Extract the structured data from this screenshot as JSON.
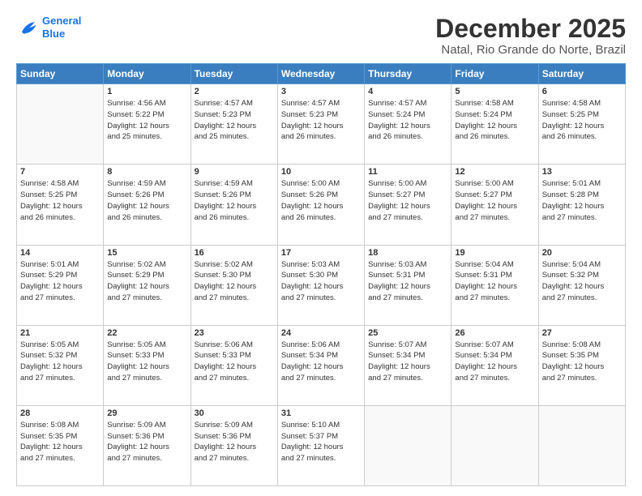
{
  "logo": {
    "line1": "General",
    "line2": "Blue"
  },
  "title": "December 2025",
  "subtitle": "Natal, Rio Grande do Norte, Brazil",
  "weekdays": [
    "Sunday",
    "Monday",
    "Tuesday",
    "Wednesday",
    "Thursday",
    "Friday",
    "Saturday"
  ],
  "weeks": [
    [
      {
        "day": "",
        "lines": []
      },
      {
        "day": "1",
        "lines": [
          "Sunrise: 4:56 AM",
          "Sunset: 5:22 PM",
          "Daylight: 12 hours",
          "and 25 minutes."
        ]
      },
      {
        "day": "2",
        "lines": [
          "Sunrise: 4:57 AM",
          "Sunset: 5:23 PM",
          "Daylight: 12 hours",
          "and 25 minutes."
        ]
      },
      {
        "day": "3",
        "lines": [
          "Sunrise: 4:57 AM",
          "Sunset: 5:23 PM",
          "Daylight: 12 hours",
          "and 26 minutes."
        ]
      },
      {
        "day": "4",
        "lines": [
          "Sunrise: 4:57 AM",
          "Sunset: 5:24 PM",
          "Daylight: 12 hours",
          "and 26 minutes."
        ]
      },
      {
        "day": "5",
        "lines": [
          "Sunrise: 4:58 AM",
          "Sunset: 5:24 PM",
          "Daylight: 12 hours",
          "and 26 minutes."
        ]
      },
      {
        "day": "6",
        "lines": [
          "Sunrise: 4:58 AM",
          "Sunset: 5:25 PM",
          "Daylight: 12 hours",
          "and 26 minutes."
        ]
      }
    ],
    [
      {
        "day": "7",
        "lines": [
          "Sunrise: 4:58 AM",
          "Sunset: 5:25 PM",
          "Daylight: 12 hours",
          "and 26 minutes."
        ]
      },
      {
        "day": "8",
        "lines": [
          "Sunrise: 4:59 AM",
          "Sunset: 5:26 PM",
          "Daylight: 12 hours",
          "and 26 minutes."
        ]
      },
      {
        "day": "9",
        "lines": [
          "Sunrise: 4:59 AM",
          "Sunset: 5:26 PM",
          "Daylight: 12 hours",
          "and 26 minutes."
        ]
      },
      {
        "day": "10",
        "lines": [
          "Sunrise: 5:00 AM",
          "Sunset: 5:26 PM",
          "Daylight: 12 hours",
          "and 26 minutes."
        ]
      },
      {
        "day": "11",
        "lines": [
          "Sunrise: 5:00 AM",
          "Sunset: 5:27 PM",
          "Daylight: 12 hours",
          "and 27 minutes."
        ]
      },
      {
        "day": "12",
        "lines": [
          "Sunrise: 5:00 AM",
          "Sunset: 5:27 PM",
          "Daylight: 12 hours",
          "and 27 minutes."
        ]
      },
      {
        "day": "13",
        "lines": [
          "Sunrise: 5:01 AM",
          "Sunset: 5:28 PM",
          "Daylight: 12 hours",
          "and 27 minutes."
        ]
      }
    ],
    [
      {
        "day": "14",
        "lines": [
          "Sunrise: 5:01 AM",
          "Sunset: 5:29 PM",
          "Daylight: 12 hours",
          "and 27 minutes."
        ]
      },
      {
        "day": "15",
        "lines": [
          "Sunrise: 5:02 AM",
          "Sunset: 5:29 PM",
          "Daylight: 12 hours",
          "and 27 minutes."
        ]
      },
      {
        "day": "16",
        "lines": [
          "Sunrise: 5:02 AM",
          "Sunset: 5:30 PM",
          "Daylight: 12 hours",
          "and 27 minutes."
        ]
      },
      {
        "day": "17",
        "lines": [
          "Sunrise: 5:03 AM",
          "Sunset: 5:30 PM",
          "Daylight: 12 hours",
          "and 27 minutes."
        ]
      },
      {
        "day": "18",
        "lines": [
          "Sunrise: 5:03 AM",
          "Sunset: 5:31 PM",
          "Daylight: 12 hours",
          "and 27 minutes."
        ]
      },
      {
        "day": "19",
        "lines": [
          "Sunrise: 5:04 AM",
          "Sunset: 5:31 PM",
          "Daylight: 12 hours",
          "and 27 minutes."
        ]
      },
      {
        "day": "20",
        "lines": [
          "Sunrise: 5:04 AM",
          "Sunset: 5:32 PM",
          "Daylight: 12 hours",
          "and 27 minutes."
        ]
      }
    ],
    [
      {
        "day": "21",
        "lines": [
          "Sunrise: 5:05 AM",
          "Sunset: 5:32 PM",
          "Daylight: 12 hours",
          "and 27 minutes."
        ]
      },
      {
        "day": "22",
        "lines": [
          "Sunrise: 5:05 AM",
          "Sunset: 5:33 PM",
          "Daylight: 12 hours",
          "and 27 minutes."
        ]
      },
      {
        "day": "23",
        "lines": [
          "Sunrise: 5:06 AM",
          "Sunset: 5:33 PM",
          "Daylight: 12 hours",
          "and 27 minutes."
        ]
      },
      {
        "day": "24",
        "lines": [
          "Sunrise: 5:06 AM",
          "Sunset: 5:34 PM",
          "Daylight: 12 hours",
          "and 27 minutes."
        ]
      },
      {
        "day": "25",
        "lines": [
          "Sunrise: 5:07 AM",
          "Sunset: 5:34 PM",
          "Daylight: 12 hours",
          "and 27 minutes."
        ]
      },
      {
        "day": "26",
        "lines": [
          "Sunrise: 5:07 AM",
          "Sunset: 5:34 PM",
          "Daylight: 12 hours",
          "and 27 minutes."
        ]
      },
      {
        "day": "27",
        "lines": [
          "Sunrise: 5:08 AM",
          "Sunset: 5:35 PM",
          "Daylight: 12 hours",
          "and 27 minutes."
        ]
      }
    ],
    [
      {
        "day": "28",
        "lines": [
          "Sunrise: 5:08 AM",
          "Sunset: 5:35 PM",
          "Daylight: 12 hours",
          "and 27 minutes."
        ]
      },
      {
        "day": "29",
        "lines": [
          "Sunrise: 5:09 AM",
          "Sunset: 5:36 PM",
          "Daylight: 12 hours",
          "and 27 minutes."
        ]
      },
      {
        "day": "30",
        "lines": [
          "Sunrise: 5:09 AM",
          "Sunset: 5:36 PM",
          "Daylight: 12 hours",
          "and 27 minutes."
        ]
      },
      {
        "day": "31",
        "lines": [
          "Sunrise: 5:10 AM",
          "Sunset: 5:37 PM",
          "Daylight: 12 hours",
          "and 27 minutes."
        ]
      },
      {
        "day": "",
        "lines": []
      },
      {
        "day": "",
        "lines": []
      },
      {
        "day": "",
        "lines": []
      }
    ]
  ]
}
